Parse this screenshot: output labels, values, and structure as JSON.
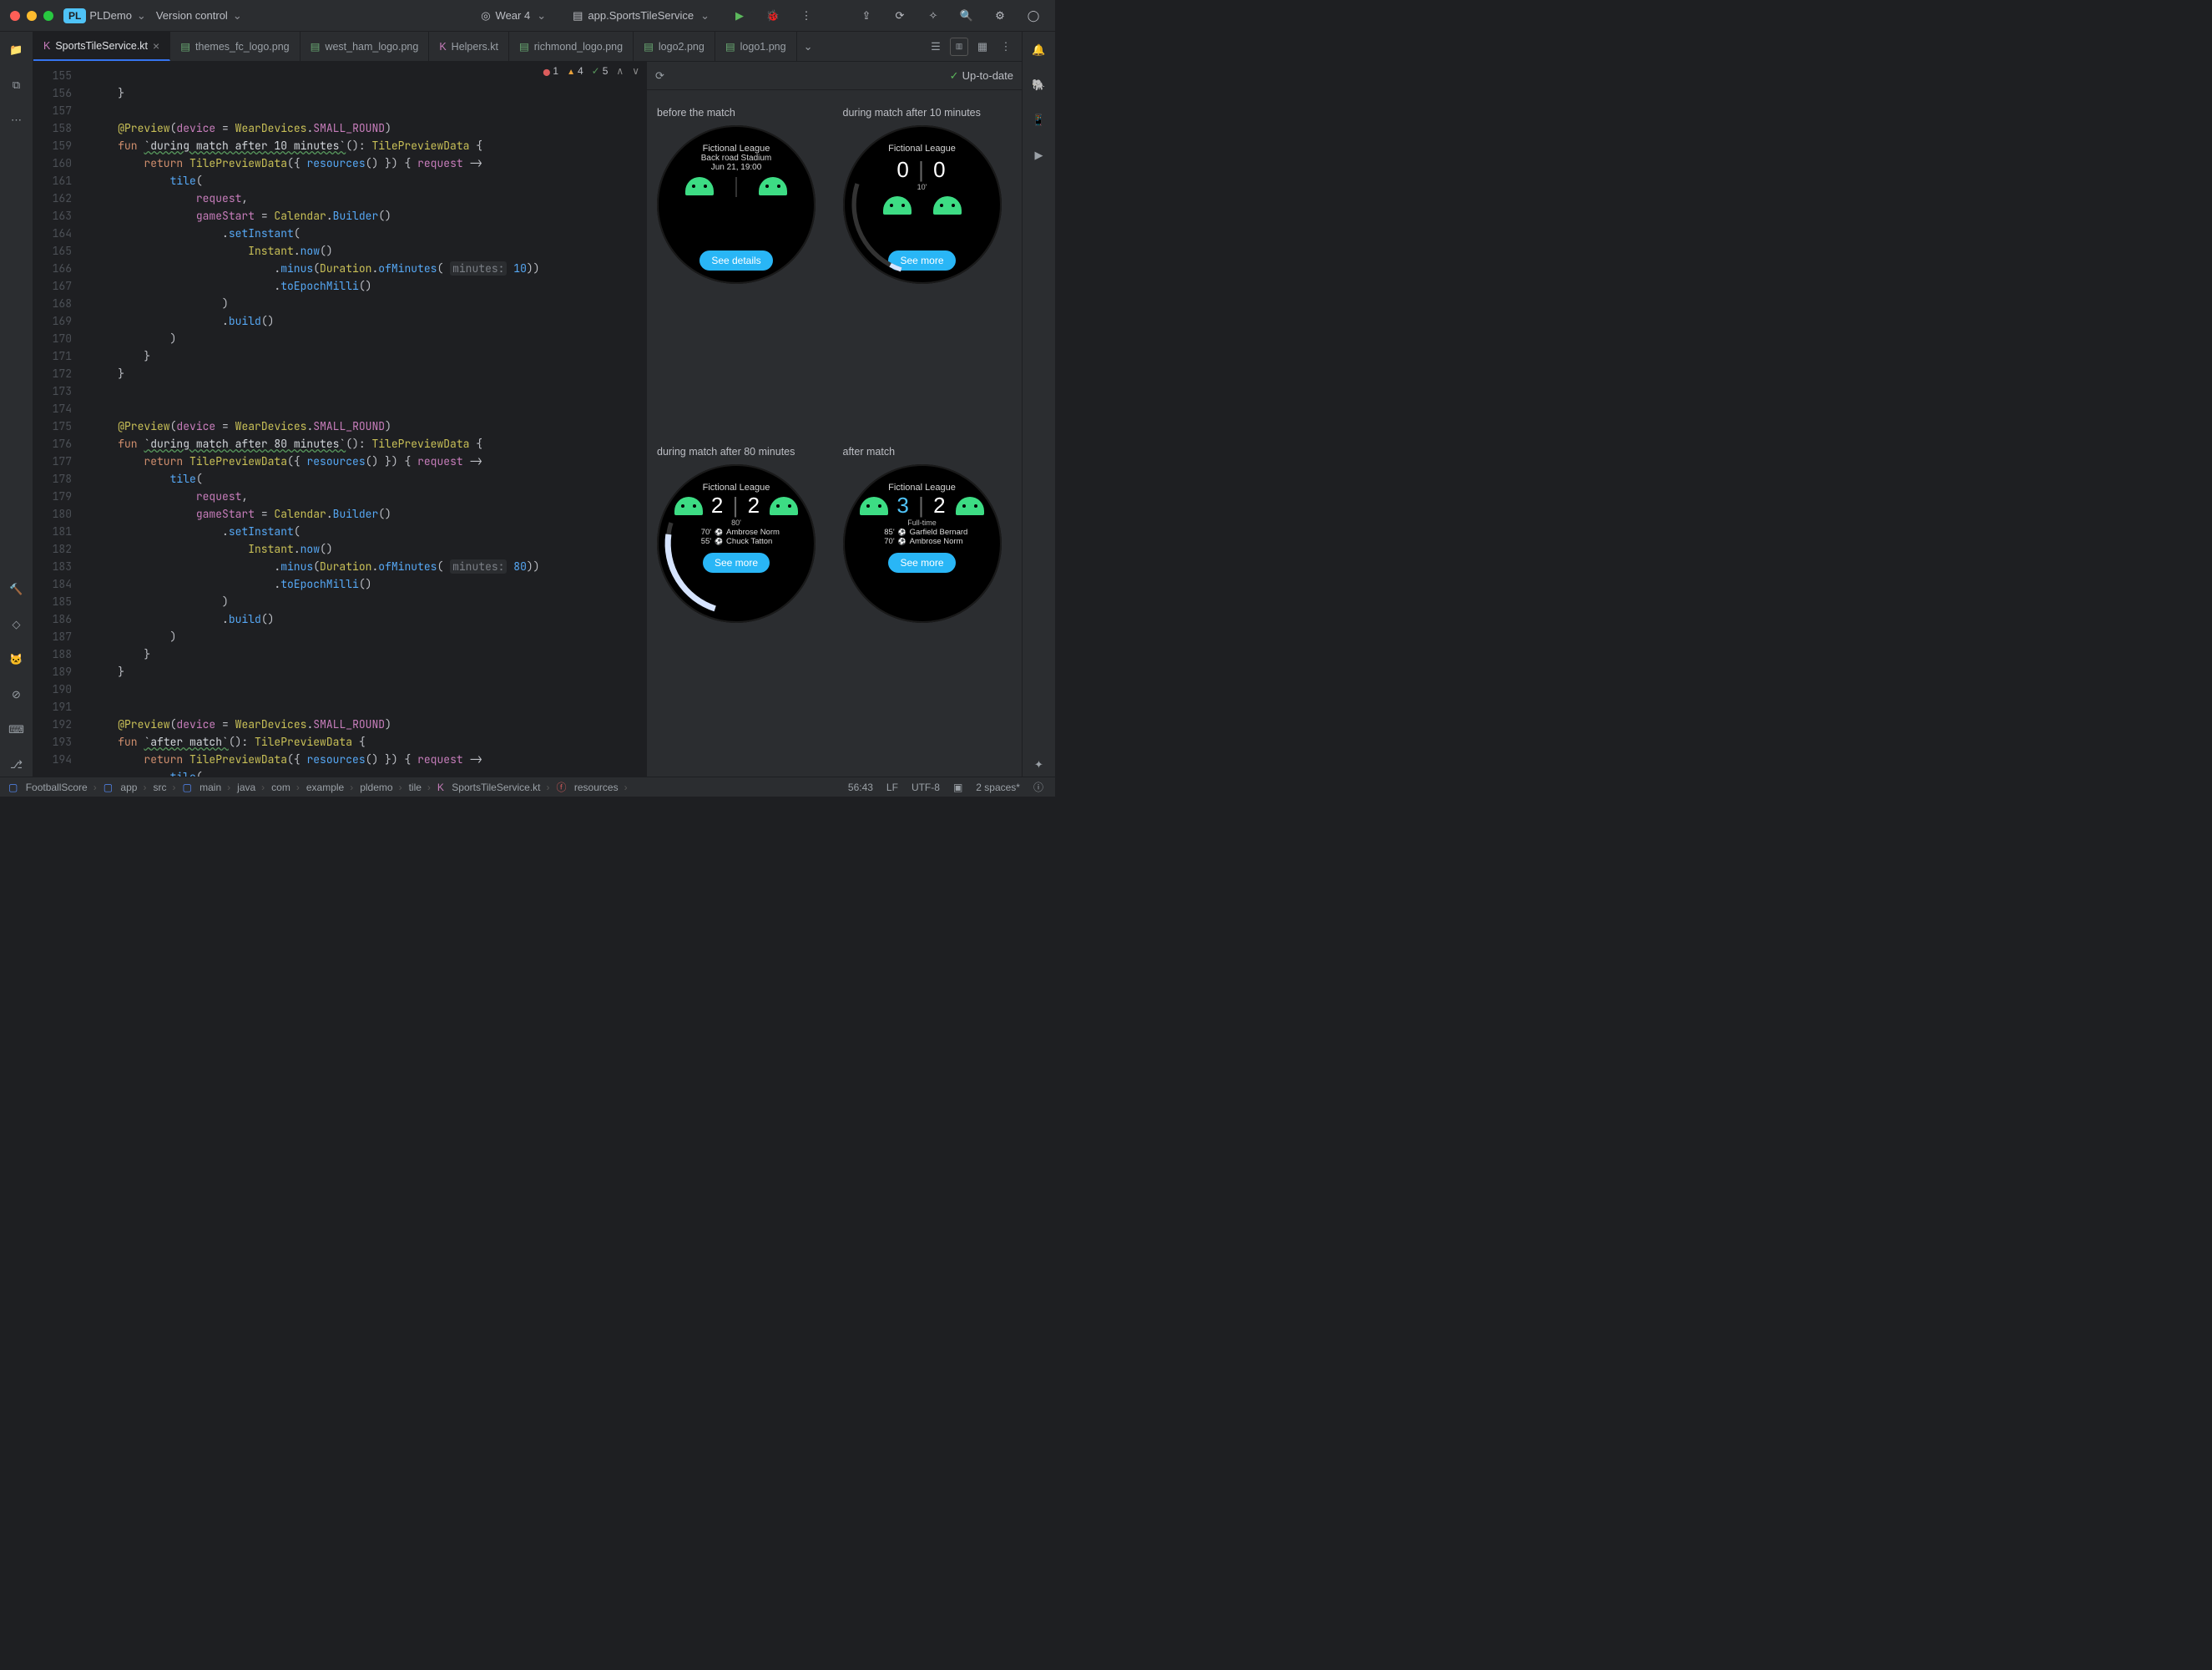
{
  "titlebar": {
    "project_badge": "PL",
    "project_name": "PLDemo",
    "menu_vcs": "Version control",
    "device": "Wear 4",
    "run_config": "app.SportsTileService"
  },
  "tabs": {
    "items": [
      {
        "label": "SportsTileService.kt",
        "icon": "kotlin",
        "active": true
      },
      {
        "label": "themes_fc_logo.png",
        "icon": "image"
      },
      {
        "label": "west_ham_logo.png",
        "icon": "image"
      },
      {
        "label": "Helpers.kt",
        "icon": "kotlin"
      },
      {
        "label": "richmond_logo.png",
        "icon": "image"
      },
      {
        "label": "logo2.png",
        "icon": "image"
      },
      {
        "label": "logo1.png",
        "icon": "image"
      }
    ]
  },
  "inspections": {
    "errors": "1",
    "warnings": "4",
    "weak": "5"
  },
  "editor": {
    "line_start": 155,
    "line_end": 194,
    "lines": [
      "",
      "    }",
      "",
      "    @Preview(device = WearDevices.SMALL_ROUND)",
      "    fun `during match after 10 minutes`(): TilePreviewData {",
      "        return TilePreviewData({ resources() }) { request ->",
      "            tile(",
      "                request,",
      "                gameStart = Calendar.Builder()",
      "                    .setInstant(",
      "                        Instant.now()",
      "                            .minus(Duration.ofMinutes( minutes: 10))",
      "                            .toEpochMilli()",
      "                    )",
      "                    .build()",
      "            )",
      "        }",
      "    }",
      "",
      "",
      "    @Preview(device = WearDevices.SMALL_ROUND)",
      "    fun `during match after 80 minutes`(): TilePreviewData {",
      "        return TilePreviewData({ resources() }) { request ->",
      "            tile(",
      "                request,",
      "                gameStart = Calendar.Builder()",
      "                    .setInstant(",
      "                        Instant.now()",
      "                            .minus(Duration.ofMinutes( minutes: 80))",
      "                            .toEpochMilli()",
      "                    )",
      "                    .build()",
      "            )",
      "        }",
      "    }",
      "",
      "",
      "    @Preview(device = WearDevices.SMALL_ROUND)",
      "    fun `after match`(): TilePreviewData {",
      "        return TilePreviewData({ resources() }) { request ->",
      "            tile("
    ]
  },
  "preview": {
    "status": "Up-to-date",
    "cells": [
      {
        "title": "before the match",
        "league": "Fictional League",
        "line2": "Back road Stadium",
        "line3": "Jun 21, 19:00",
        "button": "See details"
      },
      {
        "title": "during match after 10 minutes",
        "league": "Fictional League",
        "score_a": "0",
        "score_b": "0",
        "minute": "10'",
        "button": "See more"
      },
      {
        "title": "during match after 80 minutes",
        "league": "Fictional League",
        "score_a": "2",
        "score_b": "2",
        "minute": "80'",
        "scorers": [
          "70'  Ambrose Norm",
          "55'  Chuck Tatton"
        ],
        "button": "See more"
      },
      {
        "title": "after match",
        "league": "Fictional League",
        "score_a": "3",
        "score_b": "2",
        "minute": "Full-time",
        "highlight_a": true,
        "scorers": [
          "85'  Garfield Bernard",
          "70'  Ambrose Norm"
        ],
        "button": "See more"
      }
    ]
  },
  "breadcrumbs": [
    "FootballScore",
    "app",
    "src",
    "main",
    "java",
    "com",
    "example",
    "pldemo",
    "tile",
    "SportsTileService.kt",
    "resources"
  ],
  "statusbar_right": {
    "caret": "56:43",
    "line_sep": "LF",
    "encoding": "UTF-8",
    "indent": "2 spaces*"
  }
}
